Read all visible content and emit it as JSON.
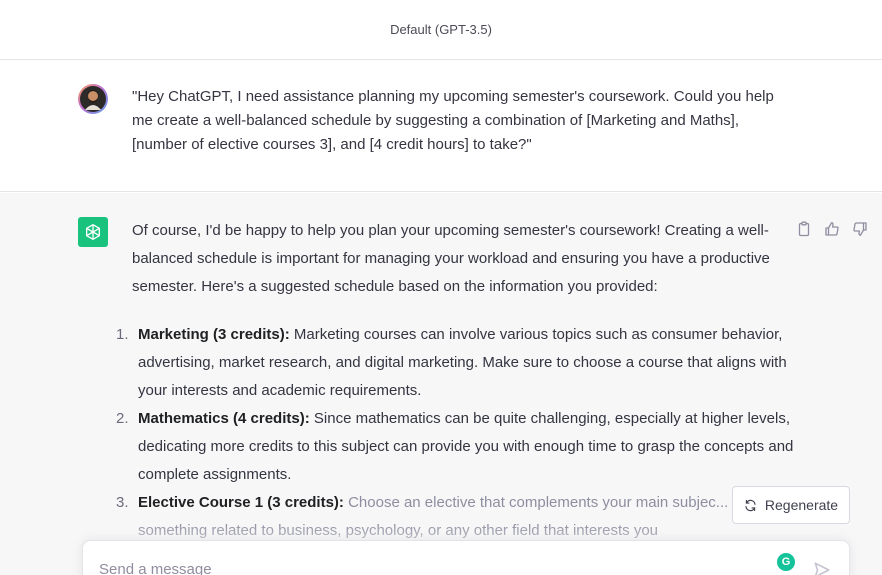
{
  "header": {
    "model_label": "Default (GPT-3.5)"
  },
  "user_message": {
    "text": "\"Hey ChatGPT, I need assistance planning my upcoming semester's coursework. Could you help me create a well-balanced schedule by suggesting a combination of [Marketing and Maths], [number of elective courses 3], and [4 credit hours] to take?\""
  },
  "assistant_message": {
    "intro": "Of course, I'd be happy to help you plan your upcoming semester's coursework! Creating a well-balanced schedule is important for managing your workload and ensuring you have a productive semester. Here's a suggested schedule based on the information you provided:",
    "items": [
      {
        "number": "1.",
        "title": "Marketing (3 credits):",
        "body": " Marketing courses can involve various topics such as consumer behavior, advertising, market research, and digital marketing. Make sure to choose a course that aligns with your interests and academic requirements."
      },
      {
        "number": "2.",
        "title": "Mathematics (4 credits):",
        "body": " Since mathematics can be quite challenging, especially at higher levels, dedicating more credits to this subject can provide you with enough time to grasp the concepts and complete assignments."
      },
      {
        "number": "3.",
        "title": "Elective Course 1 (3 credits):",
        "body": " Choose an elective that complements your main subjec... could be something related to business, psychology, or any other field that interests you"
      }
    ],
    "action_icons": [
      "copy-icon",
      "thumbs-up-icon",
      "thumbs-down-icon"
    ]
  },
  "regenerate": {
    "label": "Regenerate",
    "icon": "refresh-icon"
  },
  "composer": {
    "placeholder": "Send a message",
    "extension_badge": "G",
    "send_icon": "send-icon"
  },
  "colors": {
    "brand_green": "#19c37d",
    "assistant_bg": "#f7f7f8",
    "text": "#343541",
    "grammarly_green": "#15c39a"
  }
}
